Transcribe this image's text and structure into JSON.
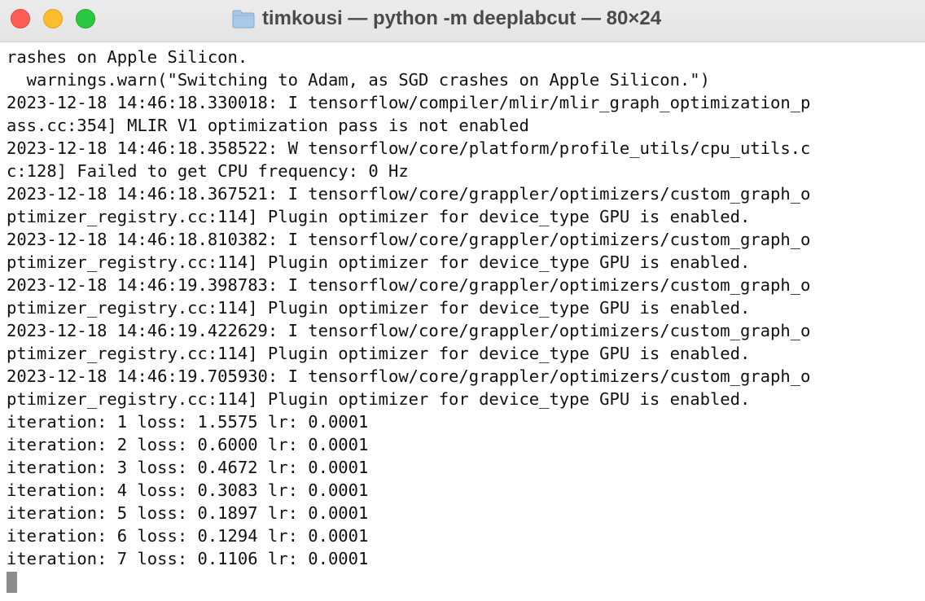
{
  "window": {
    "title": "timkousi — python -m deeplabcut — 80×24",
    "icons": {
      "folder": "folder-icon",
      "close": "close-icon",
      "minimize": "minimize-icon",
      "zoom": "zoom-icon"
    },
    "colors": {
      "close": "#ff5f57",
      "minimize": "#febc2e",
      "zoom": "#28c840"
    }
  },
  "terminal": {
    "lines": [
      "rashes on Apple Silicon.",
      "  warnings.warn(\"Switching to Adam, as SGD crashes on Apple Silicon.\")",
      "2023-12-18 14:46:18.330018: I tensorflow/compiler/mlir/mlir_graph_optimization_p",
      "ass.cc:354] MLIR V1 optimization pass is not enabled",
      "2023-12-18 14:46:18.358522: W tensorflow/core/platform/profile_utils/cpu_utils.c",
      "c:128] Failed to get CPU frequency: 0 Hz",
      "2023-12-18 14:46:18.367521: I tensorflow/core/grappler/optimizers/custom_graph_o",
      "ptimizer_registry.cc:114] Plugin optimizer for device_type GPU is enabled.",
      "2023-12-18 14:46:18.810382: I tensorflow/core/grappler/optimizers/custom_graph_o",
      "ptimizer_registry.cc:114] Plugin optimizer for device_type GPU is enabled.",
      "2023-12-18 14:46:19.398783: I tensorflow/core/grappler/optimizers/custom_graph_o",
      "ptimizer_registry.cc:114] Plugin optimizer for device_type GPU is enabled.",
      "2023-12-18 14:46:19.422629: I tensorflow/core/grappler/optimizers/custom_graph_o",
      "ptimizer_registry.cc:114] Plugin optimizer for device_type GPU is enabled.",
      "2023-12-18 14:46:19.705930: I tensorflow/core/grappler/optimizers/custom_graph_o",
      "ptimizer_registry.cc:114] Plugin optimizer for device_type GPU is enabled.",
      "iteration: 1 loss: 1.5575 lr: 0.0001",
      "iteration: 2 loss: 0.6000 lr: 0.0001",
      "iteration: 3 loss: 0.4672 lr: 0.0001",
      "iteration: 4 loss: 0.3083 lr: 0.0001",
      "iteration: 5 loss: 0.1897 lr: 0.0001",
      "iteration: 6 loss: 0.1294 lr: 0.0001",
      "iteration: 7 loss: 0.1106 lr: 0.0001"
    ]
  }
}
